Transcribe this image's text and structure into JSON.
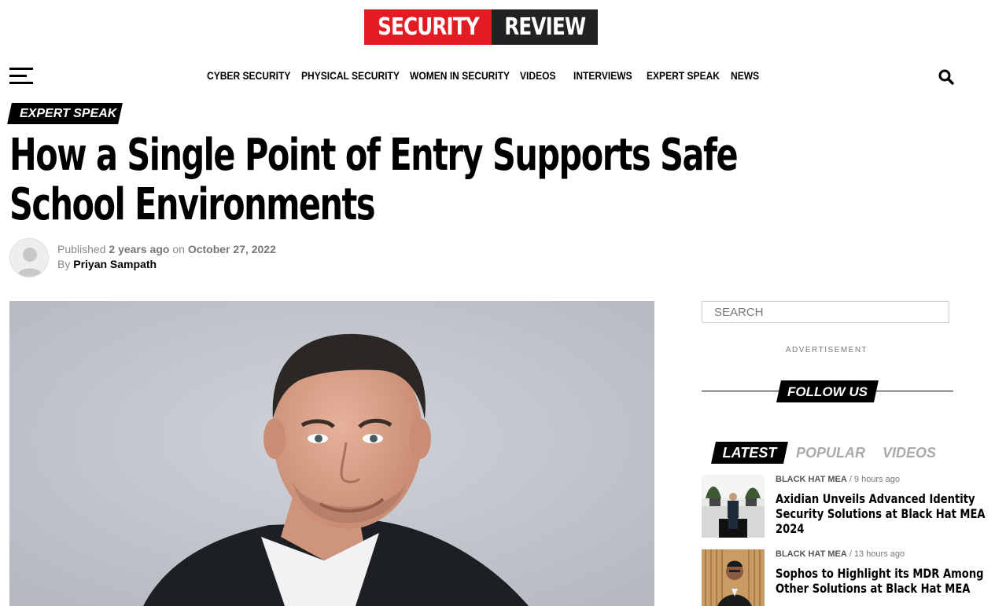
{
  "brand": {
    "logo_left": "SECURITY",
    "logo_right": "REVIEW"
  },
  "nav": {
    "items": [
      "CYBER SECURITY",
      "PHYSICAL SECURITY",
      "WOMEN IN SECURITY",
      "VIDEOS",
      "INTERVIEWS",
      "EXPERT SPEAK",
      "NEWS"
    ]
  },
  "article": {
    "category": "EXPERT SPEAK",
    "title_line1": "How a Single Point of Entry Supports Safe",
    "title_line2": "School Environments",
    "published_prefix": "Published",
    "published_relative": "2 years ago",
    "published_on": "on",
    "published_date": "October 27, 2022",
    "by_prefix": "By",
    "author": "Priyan Sampath"
  },
  "sidebar": {
    "search_placeholder": "SEARCH",
    "advertisement": "ADVERTISEMENT",
    "follow_us": "FOLLOW US",
    "tabs": [
      "LATEST",
      "POPULAR",
      "VIDEOS"
    ],
    "stories": [
      {
        "category": "BLACK HAT MEA",
        "separator": "/",
        "time": "9 hours ago",
        "headline_lines": [
          "Axidian Unveils Advanced Identity",
          "Security Solutions at Black Hat MEA",
          "2024"
        ]
      },
      {
        "category": "BLACK HAT MEA",
        "separator": "/",
        "time": "13 hours ago",
        "headline_lines": [
          "Sophos to Highlight its MDR Among",
          "Other Solutions at Black Hat MEA"
        ]
      }
    ]
  },
  "colors": {
    "brand_red": "#e31b23",
    "brand_dark": "#222222",
    "accent_black": "#000000",
    "muted": "#888888"
  },
  "icons": [
    "hamburger-menu-icon",
    "search-icon",
    "avatar-placeholder-icon"
  ]
}
